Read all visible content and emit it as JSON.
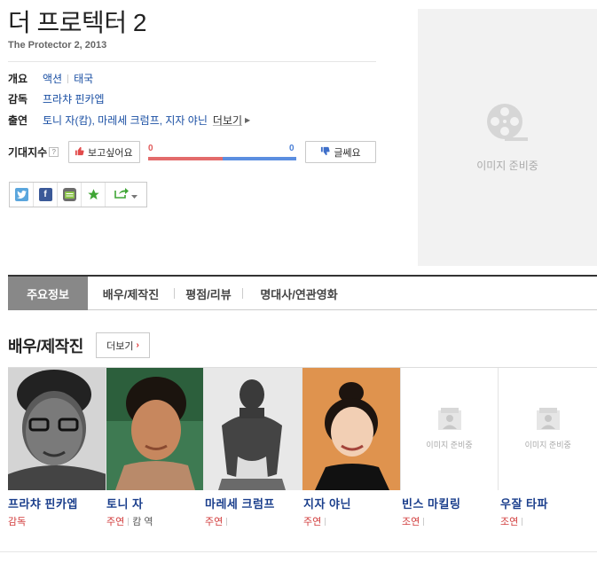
{
  "movie": {
    "title": "더 프로텍터 2",
    "subtitle": "The Protector 2, 2013"
  },
  "info": {
    "overview_label": "개요",
    "genre": "액션",
    "country": "태국",
    "director_label": "감독",
    "director": "프라챠 핀카엡",
    "cast_label": "출연",
    "cast": "토니 자(캄), 마레세 크럼프, 지자 야닌",
    "more_link": "더보기"
  },
  "expectation": {
    "label": "기대지수",
    "help": "?",
    "want_label": "보고싶어요",
    "want_count": "0",
    "no_label": "글쎄요",
    "no_count": "0",
    "want_ratio": 0.5
  },
  "share": {
    "icons": [
      "twitter-icon",
      "facebook-icon",
      "me2day-icon",
      "favorite-star-icon",
      "share-export-icon"
    ]
  },
  "poster": {
    "placeholder_text": "이미지 준비중"
  },
  "tabs": [
    {
      "label": "주요정보",
      "active": true
    },
    {
      "label": "배우/제작진",
      "active": false
    },
    {
      "label": "평점/리뷰",
      "active": false
    },
    {
      "label": "명대사/연관영화",
      "active": false
    }
  ],
  "cast_section": {
    "title": "배우/제작진",
    "more_label": "더보기",
    "photo_placeholder": "이미지 준비중",
    "people": [
      {
        "name": "프라챠 핀카엡",
        "role": "감독",
        "character": ""
      },
      {
        "name": "토니 자",
        "role": "주연",
        "character": "캄 역"
      },
      {
        "name": "마레세 크럼프",
        "role": "주연",
        "character": ""
      },
      {
        "name": "지자 야닌",
        "role": "주연",
        "character": ""
      },
      {
        "name": "빈스 마킬링",
        "role": "조연",
        "character": ""
      },
      {
        "name": "우잘 타파",
        "role": "조연",
        "character": ""
      }
    ]
  },
  "colors": {
    "link_blue": "#1a4fa3",
    "role_red": "#d13a3a",
    "gauge_red": "#e36b6b",
    "gauge_blue": "#5b8ee0"
  }
}
